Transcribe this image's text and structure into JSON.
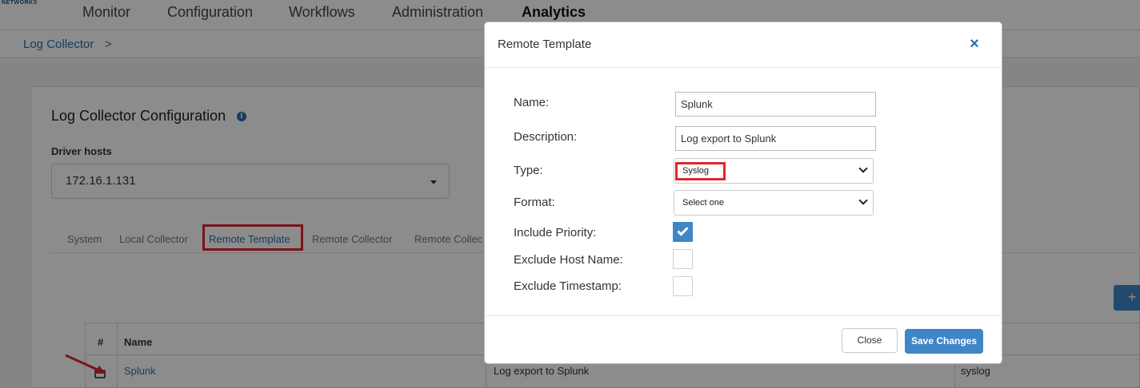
{
  "brand": {
    "text": "NETWORKS"
  },
  "nav": [
    {
      "label": "Monitor"
    },
    {
      "label": "Configuration"
    },
    {
      "label": "Workflows"
    },
    {
      "label": "Administration"
    },
    {
      "label": "Analytics",
      "active": true
    }
  ],
  "breadcrumb": {
    "item": "Log Collector",
    "separator": ">"
  },
  "card": {
    "title": "Log Collector Configuration",
    "info_icon": "i",
    "driver_hosts_label": "Driver hosts",
    "driver_host_value": "172.16.1.131"
  },
  "tabs": [
    {
      "label": "System"
    },
    {
      "label": "Local Collector"
    },
    {
      "label": "Remote Template",
      "active": true
    },
    {
      "label": "Remote Collector"
    },
    {
      "label": "Remote Collec"
    }
  ],
  "add_button": {
    "label": "+"
  },
  "table": {
    "headers": {
      "index": "#",
      "name": "Name"
    },
    "rows": [
      {
        "name": "Splunk",
        "description": "Log export to Splunk",
        "type": "syslog"
      }
    ]
  },
  "modal": {
    "title": "Remote Template",
    "close_icon": "×",
    "fields": {
      "name_label": "Name:",
      "name_value": "Splunk",
      "description_label": "Description:",
      "description_value": "Log export to Splunk",
      "type_label": "Type:",
      "type_value": "Syslog",
      "format_label": "Format:",
      "format_value": "Select one",
      "include_priority_label": "Include Priority:",
      "include_priority_checked": true,
      "exclude_host_label": "Exclude Host Name:",
      "exclude_host_checked": false,
      "exclude_timestamp_label": "Exclude Timestamp:",
      "exclude_timestamp_checked": false
    },
    "buttons": {
      "close": "Close",
      "save": "Save Changes"
    }
  },
  "colors": {
    "accent": "#3f86c8",
    "link": "#2d6db5",
    "highlight": "#e0262c"
  }
}
